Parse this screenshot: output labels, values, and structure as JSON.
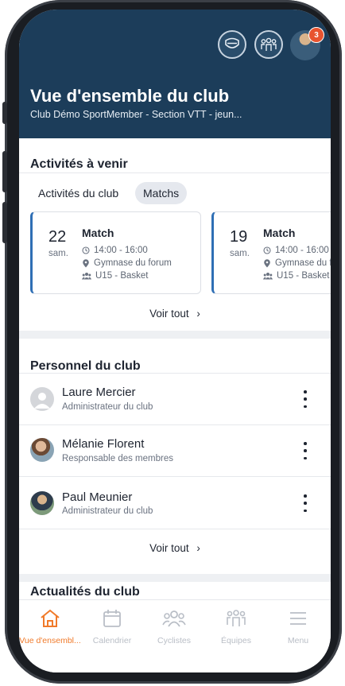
{
  "header": {
    "title": "Vue d'ensemble du club",
    "subtitle": "Club Démo SportMember - Section VTT - jeun...",
    "notification_count": "3"
  },
  "upcoming": {
    "title": "Activités à venir",
    "tabs": [
      {
        "label": "Activités du club",
        "active": false
      },
      {
        "label": "Matchs",
        "active": true
      }
    ],
    "activities": [
      {
        "day": "22",
        "weekday": "sam.",
        "title": "Match",
        "time": "14:00 - 16:00",
        "location": "Gymnase du forum",
        "team": "U15 - Basket"
      },
      {
        "day": "19",
        "weekday": "sam.",
        "title": "Match",
        "time": "14:00 - 16:00",
        "location": "Gymnase du forum",
        "team": "U15 - Basket"
      }
    ],
    "see_all": "Voir tout"
  },
  "staff": {
    "title": "Personnel du club",
    "people": [
      {
        "name": "Laure Mercier",
        "role": "Administrateur du club"
      },
      {
        "name": "Mélanie Florent",
        "role": "Responsable des membres"
      },
      {
        "name": "Paul Meunier",
        "role": "Administrateur du club"
      }
    ],
    "see_all": "Voir tout"
  },
  "news": {
    "title": "Actualités du club"
  },
  "nav": {
    "items": [
      {
        "label": "Vue d'ensembl...",
        "icon": "home-icon",
        "active": true
      },
      {
        "label": "Calendrier",
        "icon": "calendar-icon",
        "active": false
      },
      {
        "label": "Cyclistes",
        "icon": "members-icon",
        "active": false
      },
      {
        "label": "Équipes",
        "icon": "teams-icon",
        "active": false
      },
      {
        "label": "Menu",
        "icon": "menu-icon",
        "active": false
      }
    ],
    "active_color": "#f07a2a",
    "inactive_color": "#b9bec6"
  },
  "colors": {
    "header_bg": "#1c3d5a",
    "accent_blue": "#2f6fb5",
    "badge": "#e8532f"
  }
}
